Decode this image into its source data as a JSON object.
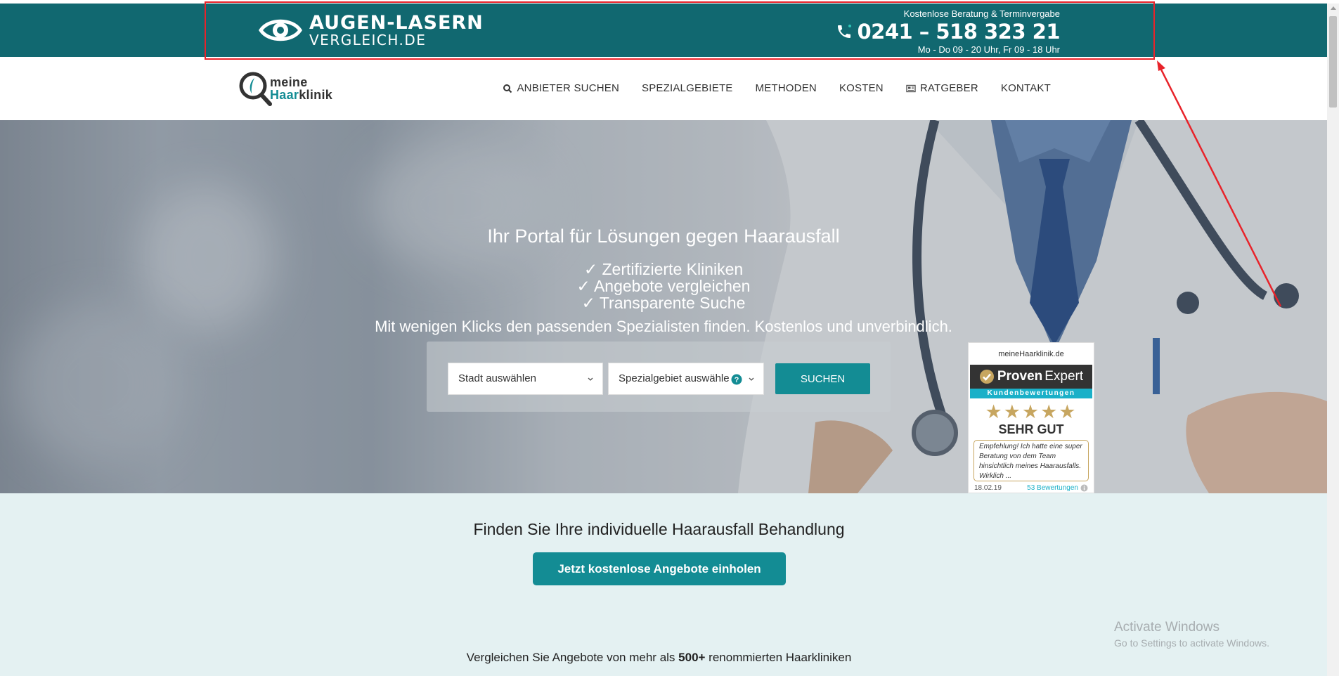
{
  "promo": {
    "logo_title": "AUGEN-LASERN",
    "logo_sub": "VERGLEICH.DE",
    "contact_label": "Kostenlose Beratung & Terminvergabe",
    "phone": "0241 – 518 323 21",
    "hours": "Mo - Do 09 - 20 Uhr, Fr 09 - 18 Uhr",
    "annotation_color": "#e8232a"
  },
  "header": {
    "logo_meine": "meine",
    "logo_haar": "Haar",
    "logo_klinik": "klinik",
    "nav": [
      {
        "label": "ANBIETER SUCHEN",
        "icon": "search-icon"
      },
      {
        "label": "SPEZIALGEBIETE"
      },
      {
        "label": "METHODEN"
      },
      {
        "label": "KOSTEN"
      },
      {
        "label": "RATGEBER",
        "icon": "newspaper-icon"
      },
      {
        "label": "KONTAKT"
      }
    ]
  },
  "hero": {
    "title": "Ihr Portal für Lösungen gegen Haarausfall",
    "checks": [
      "✓ Zertifizierte Kliniken",
      "✓ Angebote vergleichen",
      "✓ Transparente Suche"
    ],
    "tagline": "Mit wenigen Klicks den passenden Spezialisten finden. Kostenlos und unverbindlich.",
    "city_select": "Stadt auswählen",
    "specialty_select": "Spezialgebiet auswähle",
    "search_button": "SUCHEN"
  },
  "proven_expert": {
    "site": "meineHaarklinik.de",
    "brand_proven": "Proven",
    "brand_expert": "Expert",
    "sub": "Kundenbewertungen",
    "stars": "★★★★★",
    "rating": "SEHR GUT",
    "quote": "Empfehlung! Ich hatte eine super Beratung von dem Team hinsichtlich meines Haarausfalls. Wirklich ...",
    "date": "18.02.19",
    "count": "53 Bewertungen"
  },
  "lower": {
    "title": "Finden Sie Ihre individuelle Haarausfall Behandlung",
    "cta": "Jetzt kostenlose Angebote einholen",
    "compare_pre": "Vergleichen Sie Angebote von mehr als ",
    "compare_bold": "500+",
    "compare_post": " renommierten Haarkliniken"
  },
  "windows": {
    "title": "Activate Windows",
    "sub": "Go to Settings to activate Windows."
  },
  "colors": {
    "brand_teal": "#138c94",
    "banner_teal": "#116870",
    "section_bg": "#e4f1f2",
    "star_gold": "#c7a660",
    "pe_blue": "#1ab0c8"
  }
}
